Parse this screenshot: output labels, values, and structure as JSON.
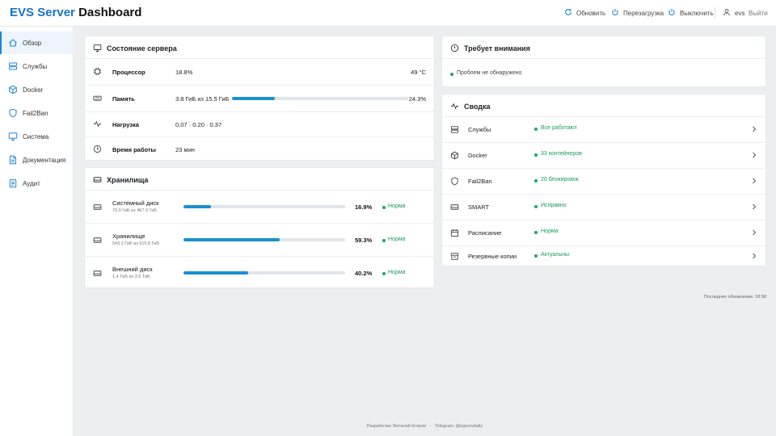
{
  "header": {
    "brand_accent": "EVS Server",
    "brand_rest": "Dashboard",
    "refresh_label": "Обновить",
    "reboot_label": "Перезагрузка",
    "shutdown_label": "Выключить",
    "username": "evs",
    "logout_label": "Выйти"
  },
  "sidebar": {
    "items": [
      {
        "label": "Обзор",
        "icon": "home-icon"
      },
      {
        "label": "Службы",
        "icon": "services-icon"
      },
      {
        "label": "Docker",
        "icon": "cube-icon"
      },
      {
        "label": "Fail2Ban",
        "icon": "shield-icon"
      },
      {
        "label": "Система",
        "icon": "monitor-icon"
      },
      {
        "label": "Документация",
        "icon": "document-icon"
      },
      {
        "label": "Аудит",
        "icon": "clipboard-icon"
      }
    ]
  },
  "server_status": {
    "title": "Состояние сервера",
    "cpu": {
      "label": "Процессор",
      "value": "18.8%",
      "temp": "49 °C"
    },
    "memory": {
      "label": "Память",
      "value": "3.8 ГиБ из 15.5 ГиБ",
      "percent_text": "24.3%",
      "percent": 24.3
    },
    "load": {
      "label": "Нагрузка",
      "value": "0.07 · 0.20 · 0.37"
    },
    "uptime": {
      "label": "Время работы",
      "value": "23 мин"
    }
  },
  "storage": {
    "title": "Хранилища",
    "disks": [
      {
        "name": "Системный диск",
        "detail": "79.0 ГиБ из 467.9 ГиБ",
        "percent": 16.9,
        "percent_text": "16.9%",
        "status": "Норма"
      },
      {
        "name": "Хранилище",
        "detail": "543.2 ГиБ из 915.8 ГиБ",
        "percent": 59.3,
        "percent_text": "59.3%",
        "status": "Норма"
      },
      {
        "name": "Внешний диск",
        "detail": "1.4 ТиБ из 3.6 ТиБ",
        "percent": 40.2,
        "percent_text": "40.2%",
        "status": "Норма"
      }
    ]
  },
  "attention": {
    "title": "Требует внимания",
    "message": "Проблем не обнаружено"
  },
  "summary": {
    "title": "Сводка",
    "items": [
      {
        "label": "Службы",
        "status": "Все работают",
        "icon": "services-icon"
      },
      {
        "label": "Docker",
        "status": "33 контейнеров",
        "icon": "cube-icon"
      },
      {
        "label": "Fail2Ban",
        "status": "20 блокировок",
        "icon": "shield-icon"
      },
      {
        "label": "SMART",
        "status": "Исправно",
        "icon": "drive-icon"
      },
      {
        "label": "Расписание",
        "status": "Норма",
        "icon": "calendar-icon"
      },
      {
        "label": "Резервные копии",
        "status": "Актуальны",
        "icon": "archive-icon"
      }
    ]
  },
  "last_update": "Последнее обновление: 18:58",
  "footer": {
    "author": "Разработка: Виталий Егоров",
    "separator": "·",
    "telegram": "Telegram: @egorovitaliy"
  },
  "colors": {
    "accent": "#1673c9",
    "bar": "#1a8fd1",
    "ok": "#1a9a5a",
    "background": "#eceef0"
  }
}
